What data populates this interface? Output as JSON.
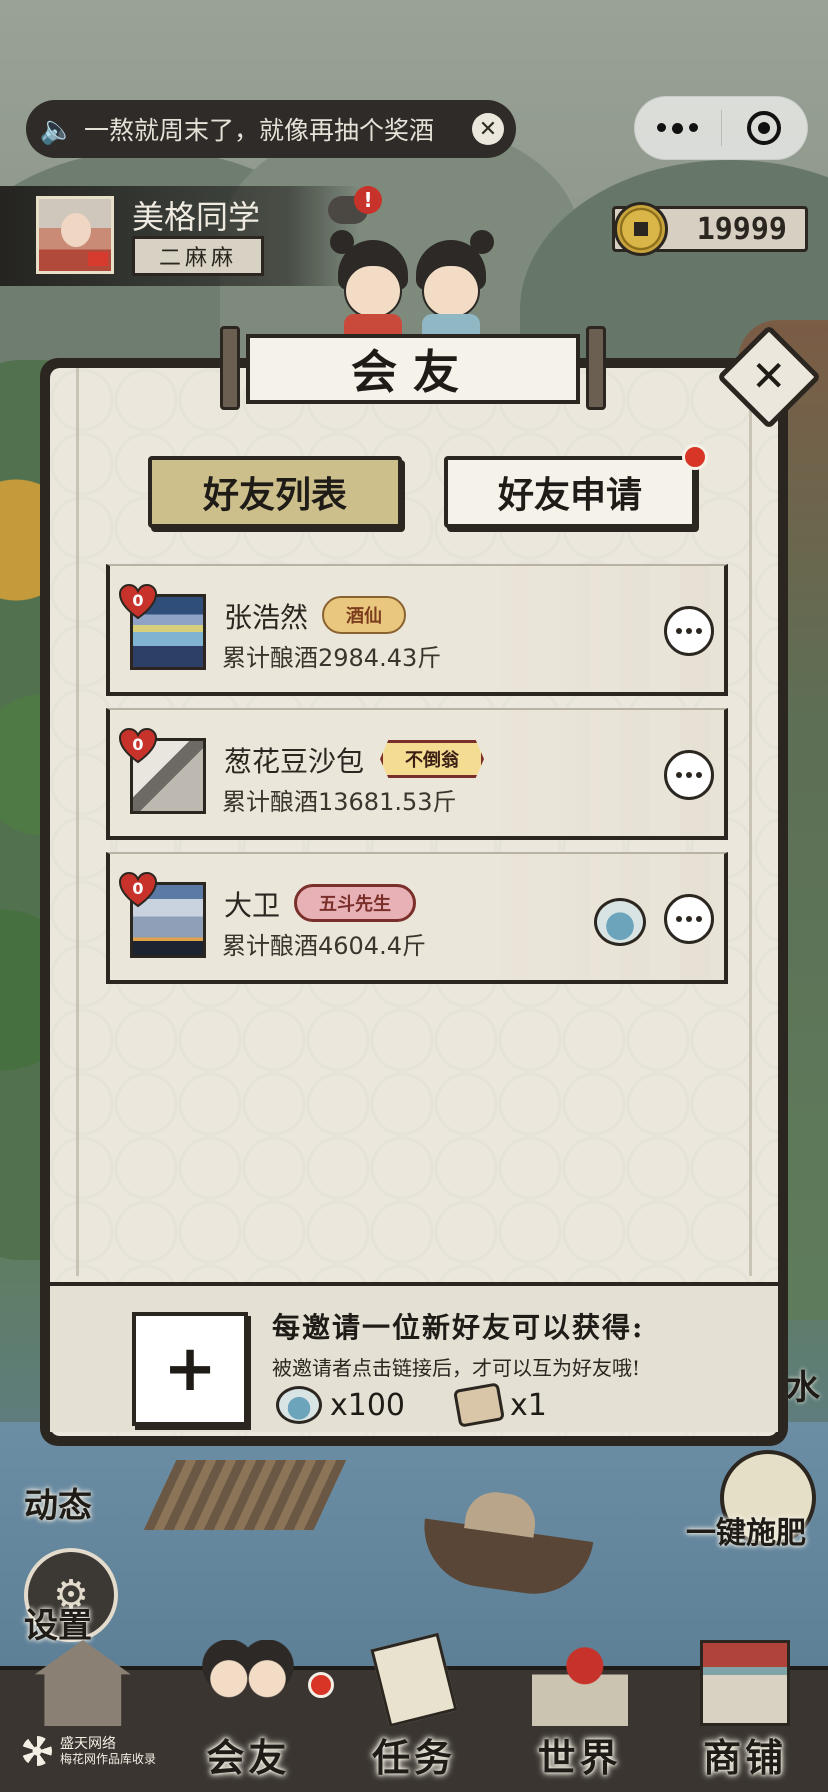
{
  "notice": {
    "text": "一熬就周末了，就像再抽个奖酒",
    "speaker_icon": "speaker-icon",
    "close_icon": "close-icon"
  },
  "capsule": {
    "more_icon": "more-dots-icon",
    "exit_icon": "target-icon"
  },
  "profile": {
    "username": "美格同学",
    "rank": "二麻麻"
  },
  "currency": {
    "amount": "19999",
    "icon": "coin-icon"
  },
  "dialog": {
    "title": "会友",
    "close_label": "✕",
    "tabs": [
      {
        "label": "好友列表",
        "active": true
      },
      {
        "label": "好友申请",
        "active": false,
        "has_dot": true
      }
    ],
    "friends": [
      {
        "name": "张浩然",
        "hearts": "0",
        "title": "酒仙",
        "stat": "累计酿酒2984.43斤",
        "has_kettle": false
      },
      {
        "name": "葱花豆沙包",
        "hearts": "0",
        "title": "不倒翁",
        "stat": "累计酿酒13681.53斤",
        "has_kettle": false
      },
      {
        "name": "大卫",
        "hearts": "0",
        "title": "五斗先生",
        "stat": "累计酿酒4604.4斤",
        "has_kettle": true
      }
    ],
    "invite": {
      "plus_label": "+",
      "headline": "每邀请一位新好友可以获得:",
      "sub": "被邀请者点击链接后，才可以互为好友哦!",
      "rewards": [
        {
          "icon": "watering-can-icon",
          "amount": "x100"
        },
        {
          "icon": "seed-packet-icon",
          "amount": "x1"
        }
      ]
    }
  },
  "side": {
    "left": [
      {
        "label": "动态"
      },
      {
        "label": "设置"
      }
    ],
    "right": {
      "label": "一键施肥"
    },
    "right_stub": "水"
  },
  "nav": [
    {
      "label": "",
      "icon": "home-icon"
    },
    {
      "label": "会友",
      "icon": "friends-icon"
    },
    {
      "label": "任务",
      "icon": "task-scroll-icon"
    },
    {
      "label": "世界",
      "icon": "world-map-icon"
    },
    {
      "label": "商铺",
      "icon": "shop-icon"
    }
  ],
  "watermark": {
    "line1": "盛天网络",
    "line2": "梅花网作品库收录"
  }
}
